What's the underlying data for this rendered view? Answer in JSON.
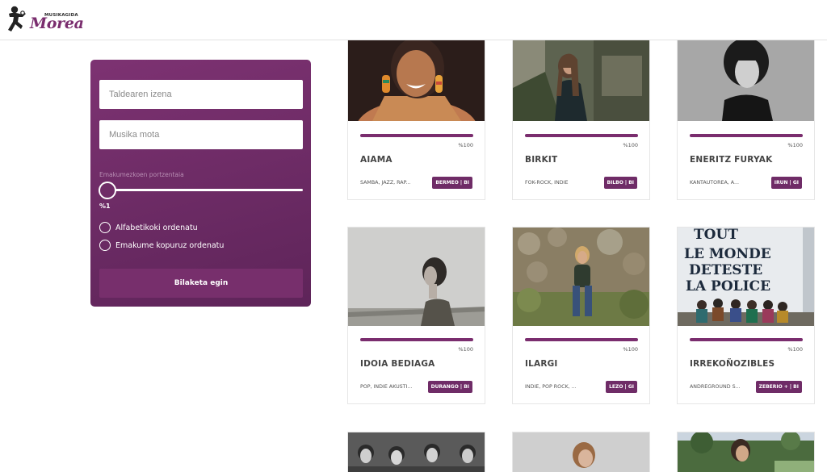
{
  "header": {
    "logo_small": "MUSIKAGIDA",
    "logo_big": "Morea"
  },
  "search": {
    "group_name_placeholder": "Taldearen izena",
    "music_type_placeholder": "Musika mota",
    "slider_label": "Emakumezkoen portzentaia",
    "slider_value": "%1",
    "slider_level": 0.01,
    "sort_alpha_label": "Alfabetikoki ordenatu",
    "sort_women_label": "Emakume kopuruz ordenatu",
    "search_button": "Bilaketa egin"
  },
  "cards": [
    {
      "name": "AIAMA",
      "percent": "%100",
      "genre": "SAMBA, JAZZ, RAP...",
      "location": "BERMEO | BI"
    },
    {
      "name": "BIRKIT",
      "percent": "%100",
      "genre": "FOK-ROCK, INDIE",
      "location": "BILBO | BI"
    },
    {
      "name": "ENERITZ FURYAK",
      "percent": "%100",
      "genre": "KANTAUTOREA, A...",
      "location": "IRUN | GI"
    },
    {
      "name": "IDOIA BEDIAGA",
      "percent": "%100",
      "genre": "POP, INDIE AKUSTI...",
      "location": "DURANGO | BI"
    },
    {
      "name": "ILARGI",
      "percent": "%100",
      "genre": "INDIE, POP ROCK, ...",
      "location": "LEZO | GI"
    },
    {
      "name": "IRREKOÑOZIBLES",
      "percent": "%100",
      "genre": "ANDREGROUND S...",
      "location": "ZEBERIO + | BI"
    }
  ],
  "photo_text": {
    "line1": "TOUT",
    "line2": "LE MONDE",
    "line3": "DETESTE",
    "line4": "LA POLICE"
  },
  "colors": {
    "brand": "#7a2d6e",
    "panel": "#6f2c67"
  }
}
